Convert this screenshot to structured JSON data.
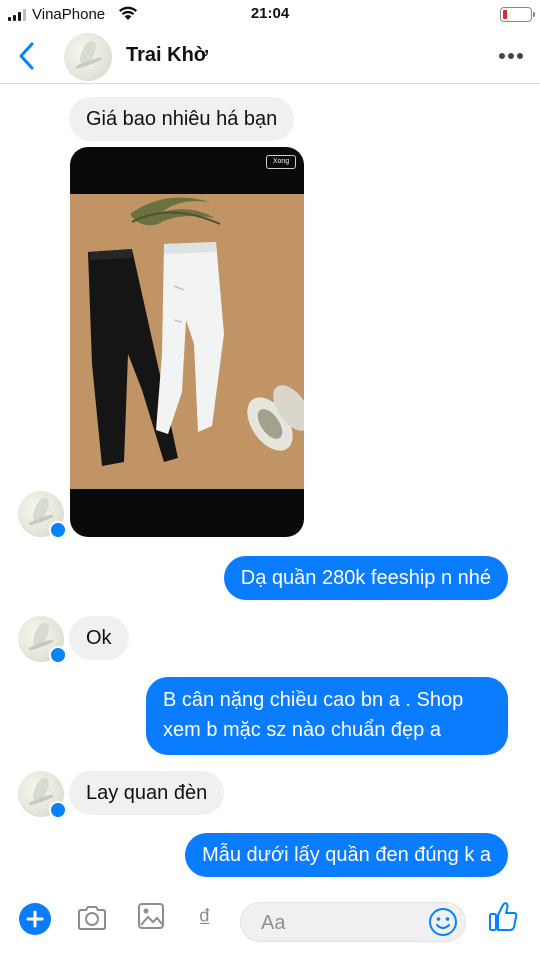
{
  "status_bar": {
    "carrier": "VinaPhone",
    "time": "21:04",
    "signal_bars_filled": 3,
    "signal_bars_total": 4,
    "icons": [
      "signal-icon",
      "wifi-icon",
      "battery-low-icon"
    ]
  },
  "header": {
    "contact_name": "Trai Khờ",
    "icons": [
      "back-chevron-icon",
      "more-dots-icon"
    ]
  },
  "messages": [
    {
      "id": "m1",
      "direction": "incoming",
      "type": "text",
      "text": "Giá bao nhiêu há bạn"
    },
    {
      "id": "m2",
      "direction": "incoming",
      "type": "image",
      "alt": "Hai chiếc quần jean đen và trắng",
      "overlay_label": "Xong"
    },
    {
      "id": "m3",
      "direction": "outgoing",
      "type": "text",
      "text": "Dạ quần 280k feeship n nhé"
    },
    {
      "id": "m4",
      "direction": "incoming",
      "type": "text",
      "text": "Ok"
    },
    {
      "id": "m5",
      "direction": "outgoing",
      "type": "text",
      "lines": [
        "B cân nặng chiều cao bn a . Shop",
        "xem b mặc sz nào chuẩn đẹp a"
      ]
    },
    {
      "id": "m6",
      "direction": "incoming",
      "type": "text",
      "text": "Lay quan đèn"
    },
    {
      "id": "m7",
      "direction": "outgoing",
      "type": "text",
      "text": "Mẫu dưới lấy quần đen đúng k a"
    }
  ],
  "composer": {
    "placeholder": "Aa",
    "currency_symbol": "₫",
    "icons": [
      "plus-icon",
      "camera-icon",
      "image-icon",
      "currency-icon",
      "emoji-icon",
      "thumbs-up-icon"
    ]
  },
  "colors": {
    "accent": "#0084ff",
    "outgoing_bubble": "#0a7cff",
    "incoming_bubble": "#f1f0f0",
    "battery_low": "#e0262b"
  }
}
